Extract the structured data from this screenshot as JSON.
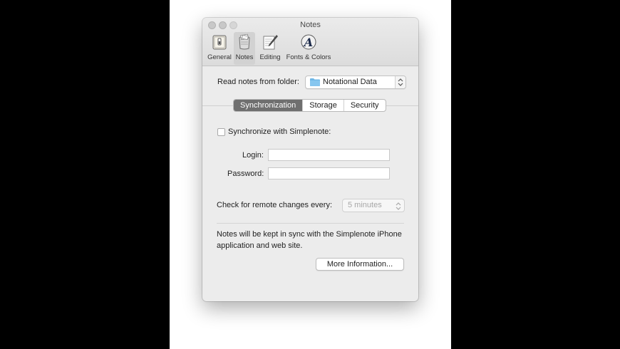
{
  "window": {
    "title": "Notes"
  },
  "toolbar": {
    "items": [
      {
        "label": "General"
      },
      {
        "label": "Notes"
      },
      {
        "label": "Editing"
      },
      {
        "label": "Fonts & Colors"
      }
    ]
  },
  "folder": {
    "label": "Read notes from folder:",
    "value": "Notational Data"
  },
  "tabs": [
    {
      "label": "Synchronization"
    },
    {
      "label": "Storage"
    },
    {
      "label": "Security"
    }
  ],
  "sync": {
    "checkbox_label": "Synchronize with Simplenote:",
    "login_label": "Login:",
    "login_value": "",
    "password_label": "Password:",
    "password_value": "",
    "check_label": "Check for remote changes every:",
    "check_value": "5 minutes",
    "info": "Notes will be kept in sync with the Simplenote iPhone application and web site.",
    "more_button": "More Information..."
  },
  "colors": {
    "active_tab": "#6f6f6f",
    "folder_icon": "#6fb7e6"
  }
}
